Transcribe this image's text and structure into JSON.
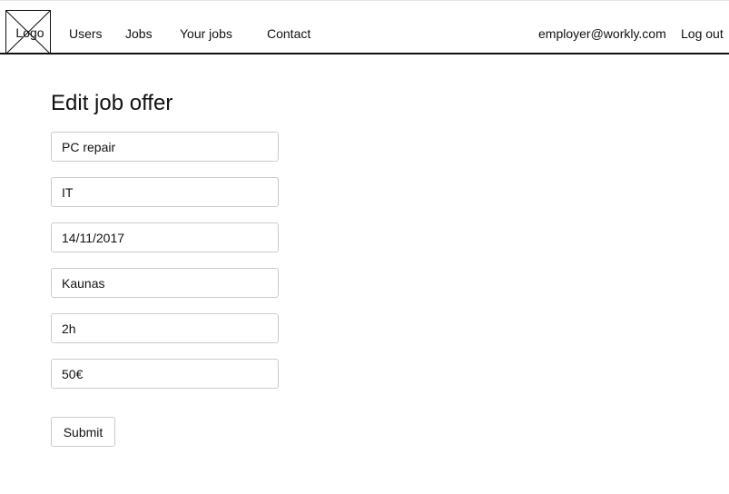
{
  "header": {
    "logo_label": "Logo",
    "nav": {
      "users": "Users",
      "jobs": "Jobs",
      "your_jobs": "Your jobs",
      "contact": "Contact"
    },
    "user_email": "employer@workly.com",
    "logout_label": "Log out"
  },
  "form": {
    "title": "Edit job offer",
    "fields": {
      "title": "PC repair",
      "category": "IT",
      "date": "14/11/2017",
      "city": "Kaunas",
      "duration": "2h",
      "pay": "50€"
    },
    "submit_label": "Submit"
  }
}
